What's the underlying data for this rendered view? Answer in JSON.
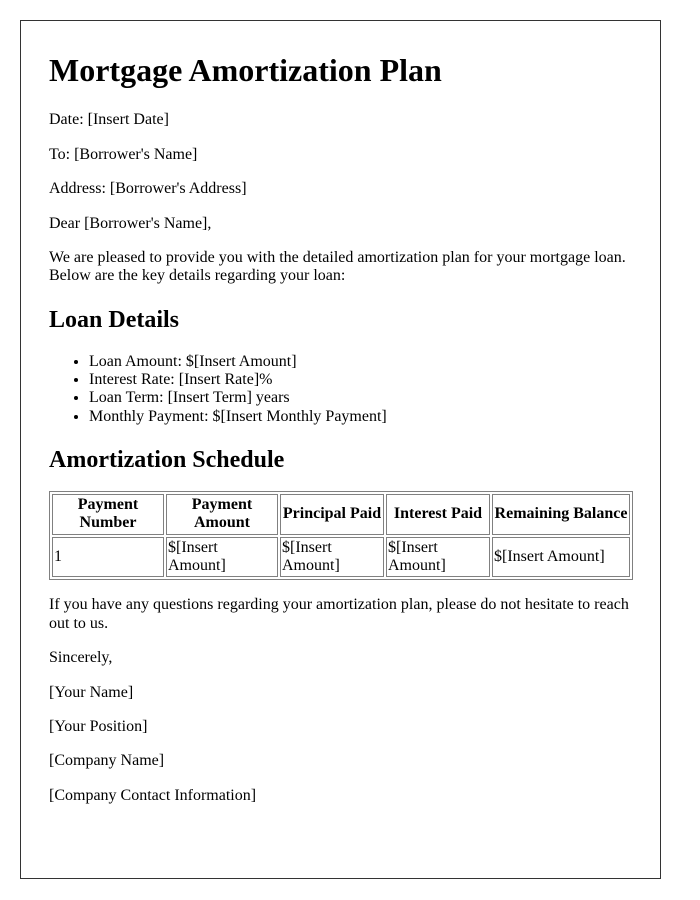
{
  "title": "Mortgage Amortization Plan",
  "header_lines": {
    "date": "Date: [Insert Date]",
    "to": "To: [Borrower's Name]",
    "address": "Address: [Borrower's Address]",
    "salutation": "Dear [Borrower's Name],"
  },
  "intro": "We are pleased to provide you with the detailed amortization plan for your mortgage loan. Below are the key details regarding your loan:",
  "loan_details": {
    "heading": "Loan Details",
    "items": [
      "Loan Amount: $[Insert Amount]",
      "Interest Rate: [Insert Rate]%",
      "Loan Term: [Insert Term] years",
      "Monthly Payment: $[Insert Monthly Payment]"
    ]
  },
  "schedule": {
    "heading": "Amortization Schedule",
    "columns": [
      "Payment Number",
      "Payment Amount",
      "Principal Paid",
      "Interest Paid",
      "Remaining Balance"
    ],
    "rows": [
      [
        "1",
        "$[Insert Amount]",
        "$[Insert Amount]",
        "$[Insert Amount]",
        "$[Insert Amount]"
      ]
    ]
  },
  "closing": "If you have any questions regarding your amortization plan, please do not hesitate to reach out to us.",
  "signoff": "Sincerely,",
  "signature": {
    "name": "[Your Name]",
    "position": "[Your Position]",
    "company": "[Company Name]",
    "contact": "[Company Contact Information]"
  }
}
